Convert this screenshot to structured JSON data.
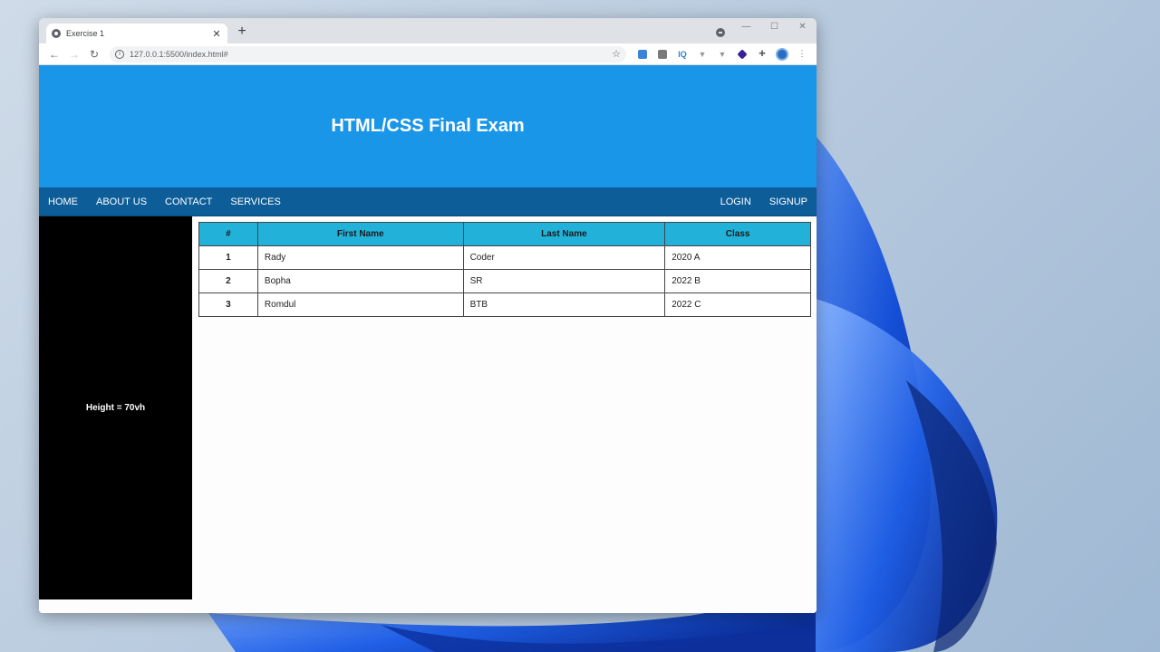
{
  "browser": {
    "tab_title": "Exercise 1",
    "url": "127.0.0.1:5500/index.html#",
    "window_controls": [
      "—",
      "☐",
      "✕"
    ]
  },
  "page": {
    "header_title": "HTML/CSS Final Exam",
    "nav_left": [
      "HOME",
      "ABOUT US",
      "CONTACT",
      "SERVICES"
    ],
    "nav_right": [
      "LOGIN",
      "SIGNUP"
    ],
    "sidebar_text": "Height = 70vh",
    "table": {
      "headers": [
        "#",
        "First Name",
        "Last Name",
        "Class"
      ],
      "rows": [
        [
          "1",
          "Rady",
          "Coder",
          "2020 A"
        ],
        [
          "2",
          "Bopha",
          "SR",
          "2022 B"
        ],
        [
          "3",
          "Romdul",
          "BTB",
          "2022 C"
        ]
      ]
    }
  },
  "colors": {
    "header_bg": "#1a96e8",
    "nav_bg": "#0d5d99",
    "table_header_bg": "#22b2d9",
    "sidebar_bg": "#000000"
  }
}
